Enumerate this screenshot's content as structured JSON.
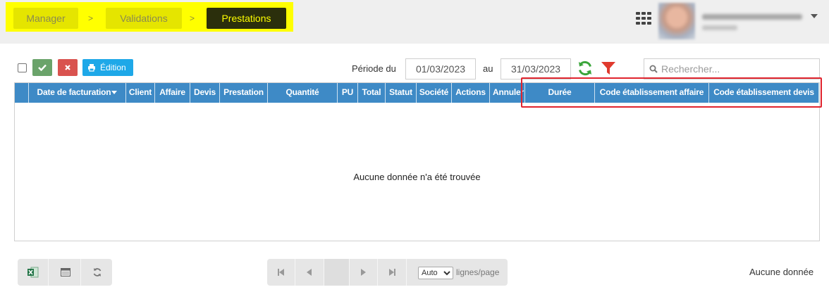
{
  "breadcrumb": {
    "items": [
      "Manager",
      "Validations",
      "Prestations"
    ],
    "separator": ">"
  },
  "toolbar": {
    "validate_icon": "check-icon",
    "reject_icon": "close-icon",
    "edition_label": "Édition",
    "periode_label": "Période du",
    "date_from": "01/03/2023",
    "au_label": "au",
    "date_to": "31/03/2023",
    "search_placeholder": "Rechercher..."
  },
  "grid": {
    "columns": [
      "Date de facturation",
      "Client",
      "Affaire",
      "Devis",
      "Prestation",
      "Quantité",
      "PU",
      "Total",
      "Statut",
      "Société",
      "Actions",
      "Annuler",
      "Durée",
      "Code établissement affaire",
      "Code établissement devis"
    ],
    "empty_message": "Aucune donnée n'a été trouvée"
  },
  "pager": {
    "page_size": "Auto",
    "page_size_options": [
      "Auto"
    ],
    "lines_label": "lignes/page",
    "status": "Aucune donnée"
  },
  "colors": {
    "header": "#3e8ac6",
    "highlight": "#ffff00",
    "active_crumb": "#2b2f0c",
    "ok_button": "#6aa36a",
    "cancel_button": "#d9534f",
    "edition_button": "#1ea8e8",
    "annotation_frame": "#e0242e"
  }
}
